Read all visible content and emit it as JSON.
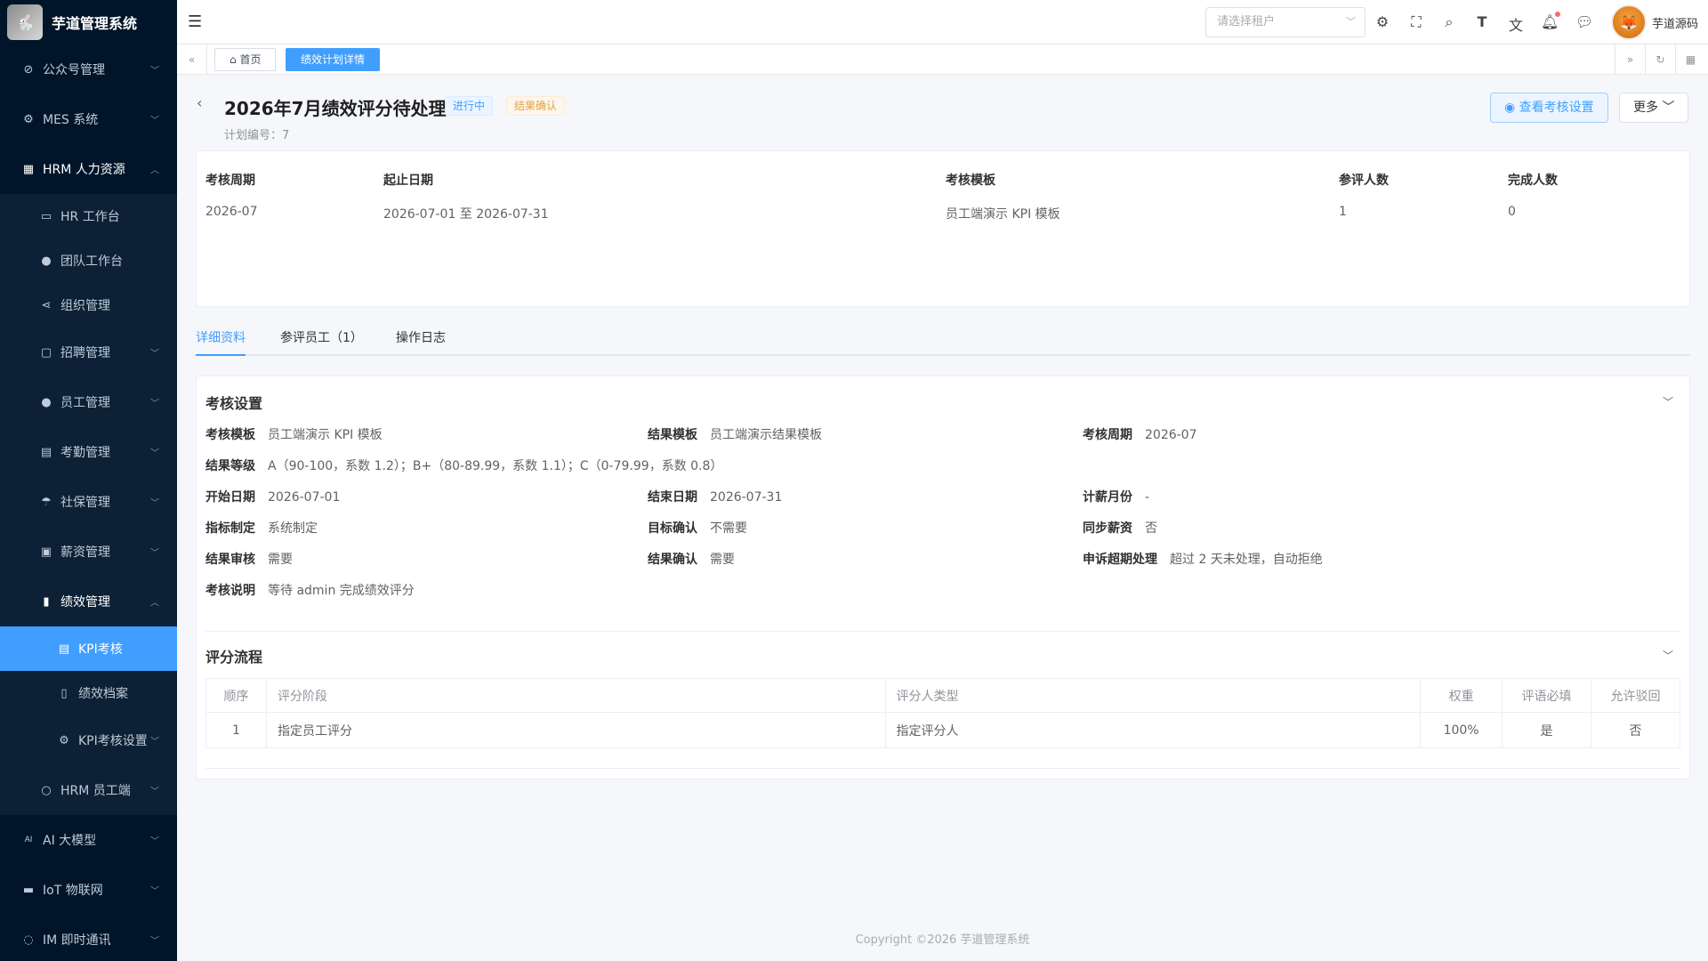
{
  "app": {
    "title": "芋道管理系统",
    "username": "芋道源码"
  },
  "sidebar": {
    "items": [
      {
        "label": "公众号管理",
        "icon": "compass-icon"
      },
      {
        "label": "MES 系统",
        "icon": "cog-icon"
      },
      {
        "label": "HRM 人力资源",
        "icon": "building-icon"
      }
    ],
    "hrm_children": [
      {
        "label": "HR 工作台",
        "icon": "monitor-icon"
      },
      {
        "label": "团队工作台",
        "icon": "user-icon"
      },
      {
        "label": "组织管理",
        "icon": "share-icon"
      },
      {
        "label": "招聘管理",
        "icon": "briefcase-icon"
      },
      {
        "label": "员工管理",
        "icon": "user-icon"
      },
      {
        "label": "考勤管理",
        "icon": "calendar-icon"
      },
      {
        "label": "社保管理",
        "icon": "umbrella-icon"
      },
      {
        "label": "薪资管理",
        "icon": "wallet-icon"
      },
      {
        "label": "绩效管理",
        "icon": "bar-chart-icon"
      }
    ],
    "perf_children": [
      {
        "label": "KPI考核",
        "icon": "calendar-icon"
      },
      {
        "label": "绩效档案",
        "icon": "book-icon"
      },
      {
        "label": "KPI考核设置",
        "icon": "gear-icon"
      }
    ],
    "hrm_staff": {
      "label": "HRM 员工端",
      "icon": "user-icon"
    },
    "bottom_items": [
      {
        "label": "AI 大模型",
        "icon": "ai-icon"
      },
      {
        "label": "IoT 物联网",
        "icon": "car-icon"
      },
      {
        "label": "IM 即时通讯",
        "icon": "chat-icon"
      }
    ]
  },
  "header": {
    "tenant_placeholder": "请选择租户"
  },
  "tags": {
    "home": "首页",
    "current": "绩效计划详情"
  },
  "page": {
    "title": "2026年7月绩效评分待处理",
    "status_badge": "进行中",
    "stage_badge": "结果确认",
    "plan_no": "计划编号：7",
    "view_btn": "查看考核设置",
    "more_btn": "更多"
  },
  "summary": [
    {
      "label": "考核周期",
      "value": "2026-07"
    },
    {
      "label": "起止日期",
      "value": "2026-07-01 至 2026-07-31"
    },
    {
      "label": "考核模板",
      "value": "员工端演示 KPI 模板"
    },
    {
      "label": "参评人数",
      "value": "1"
    },
    {
      "label": "完成人数",
      "value": "0"
    }
  ],
  "tabs": [
    "详细资料",
    "参评员工（1）",
    "操作日志"
  ],
  "settings": {
    "title": "考核设置",
    "fields": {
      "template": {
        "k": "考核模板",
        "v": "员工端演示 KPI 模板"
      },
      "result_template": {
        "k": "结果模板",
        "v": "员工端演示结果模板"
      },
      "period": {
        "k": "考核周期",
        "v": "2026-07"
      },
      "grades": {
        "k": "结果等级",
        "v": "A（90-100，系数 1.2）；B+（80-89.99，系数 1.1）；C（0-79.99，系数 0.8）"
      },
      "start": {
        "k": "开始日期",
        "v": "2026-07-01"
      },
      "end": {
        "k": "结束日期",
        "v": "2026-07-31"
      },
      "salary_month": {
        "k": "计薪月份",
        "v": "-"
      },
      "indicator": {
        "k": "指标制定",
        "v": "系统制定"
      },
      "target_confirm": {
        "k": "目标确认",
        "v": "不需要"
      },
      "sync_salary": {
        "k": "同步薪资",
        "v": "否"
      },
      "result_review": {
        "k": "结果审核",
        "v": "需要"
      },
      "result_confirm": {
        "k": "结果确认",
        "v": "需要"
      },
      "appeal": {
        "k": "申诉超期处理",
        "v": "超过 2 天未处理，自动拒绝"
      },
      "desc": {
        "k": "考核说明",
        "v": "等待 admin 完成绩效评分"
      }
    }
  },
  "flow": {
    "title": "评分流程",
    "headers": [
      "顺序",
      "评分阶段",
      "评分人类型",
      "权重",
      "评语必填",
      "允许驳回"
    ],
    "rows": [
      [
        "1",
        "指定员工评分",
        "指定评分人",
        "100%",
        "是",
        "否"
      ]
    ]
  },
  "footer": "Copyright ©2026 芋道管理系统"
}
